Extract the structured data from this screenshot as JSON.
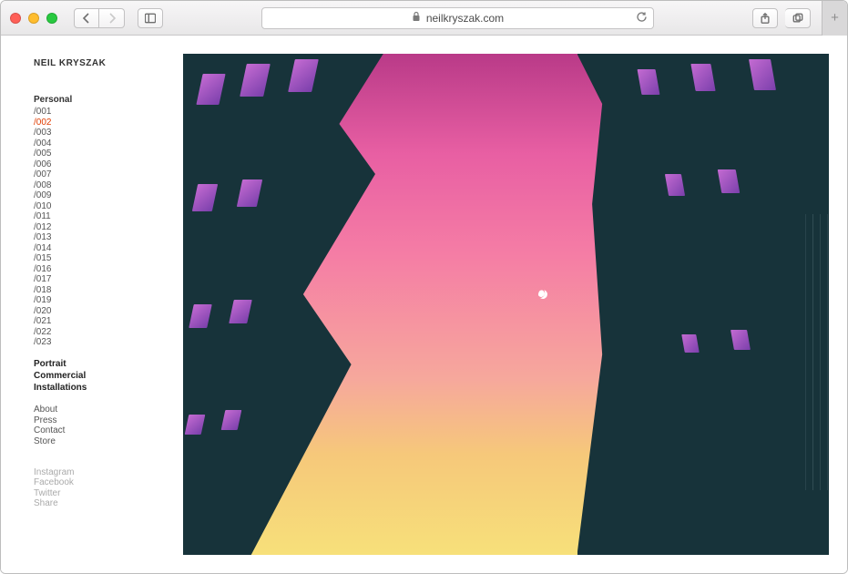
{
  "browser": {
    "url_text": "neilkryszak.com"
  },
  "site": {
    "title": "NEIL KRYSZAK"
  },
  "nav": {
    "personal_header": "Personal",
    "personal_items": [
      "/001",
      "/002",
      "/003",
      "/004",
      "/005",
      "/006",
      "/007",
      "/008",
      "/009",
      "/010",
      "/011",
      "/012",
      "/013",
      "/014",
      "/015",
      "/016",
      "/017",
      "/018",
      "/019",
      "/020",
      "/021",
      "/022",
      "/023"
    ],
    "active_personal_index": 1,
    "categories": [
      "Portrait",
      "Commercial",
      "Installations"
    ],
    "info": [
      "About",
      "Press",
      "Contact",
      "Store"
    ],
    "social": [
      "Instagram",
      "Facebook",
      "Twitter",
      "Share"
    ]
  }
}
